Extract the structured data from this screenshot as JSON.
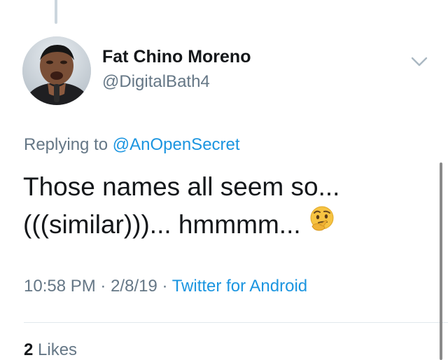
{
  "tweet": {
    "author": {
      "display_name": "Fat Chino Moreno",
      "handle": "@DigitalBath4"
    },
    "replying_prefix": "Replying to",
    "replying_to": "@AnOpenSecret",
    "text_lines": [
      "Those names all seem so...",
      "(((similar)))... hmmmm..."
    ],
    "emoji_icon": "thinking-face-icon",
    "time": "10:58 PM",
    "date": "2/8/19",
    "separator": "·",
    "source": "Twitter for Android",
    "likes_count": "2",
    "likes_label": "Likes"
  },
  "colors": {
    "link": "#1b95e0",
    "secondary_text": "#657786",
    "primary_text": "#14171a",
    "divider": "#e1e8ed",
    "thread_line": "#ccd6dd"
  }
}
